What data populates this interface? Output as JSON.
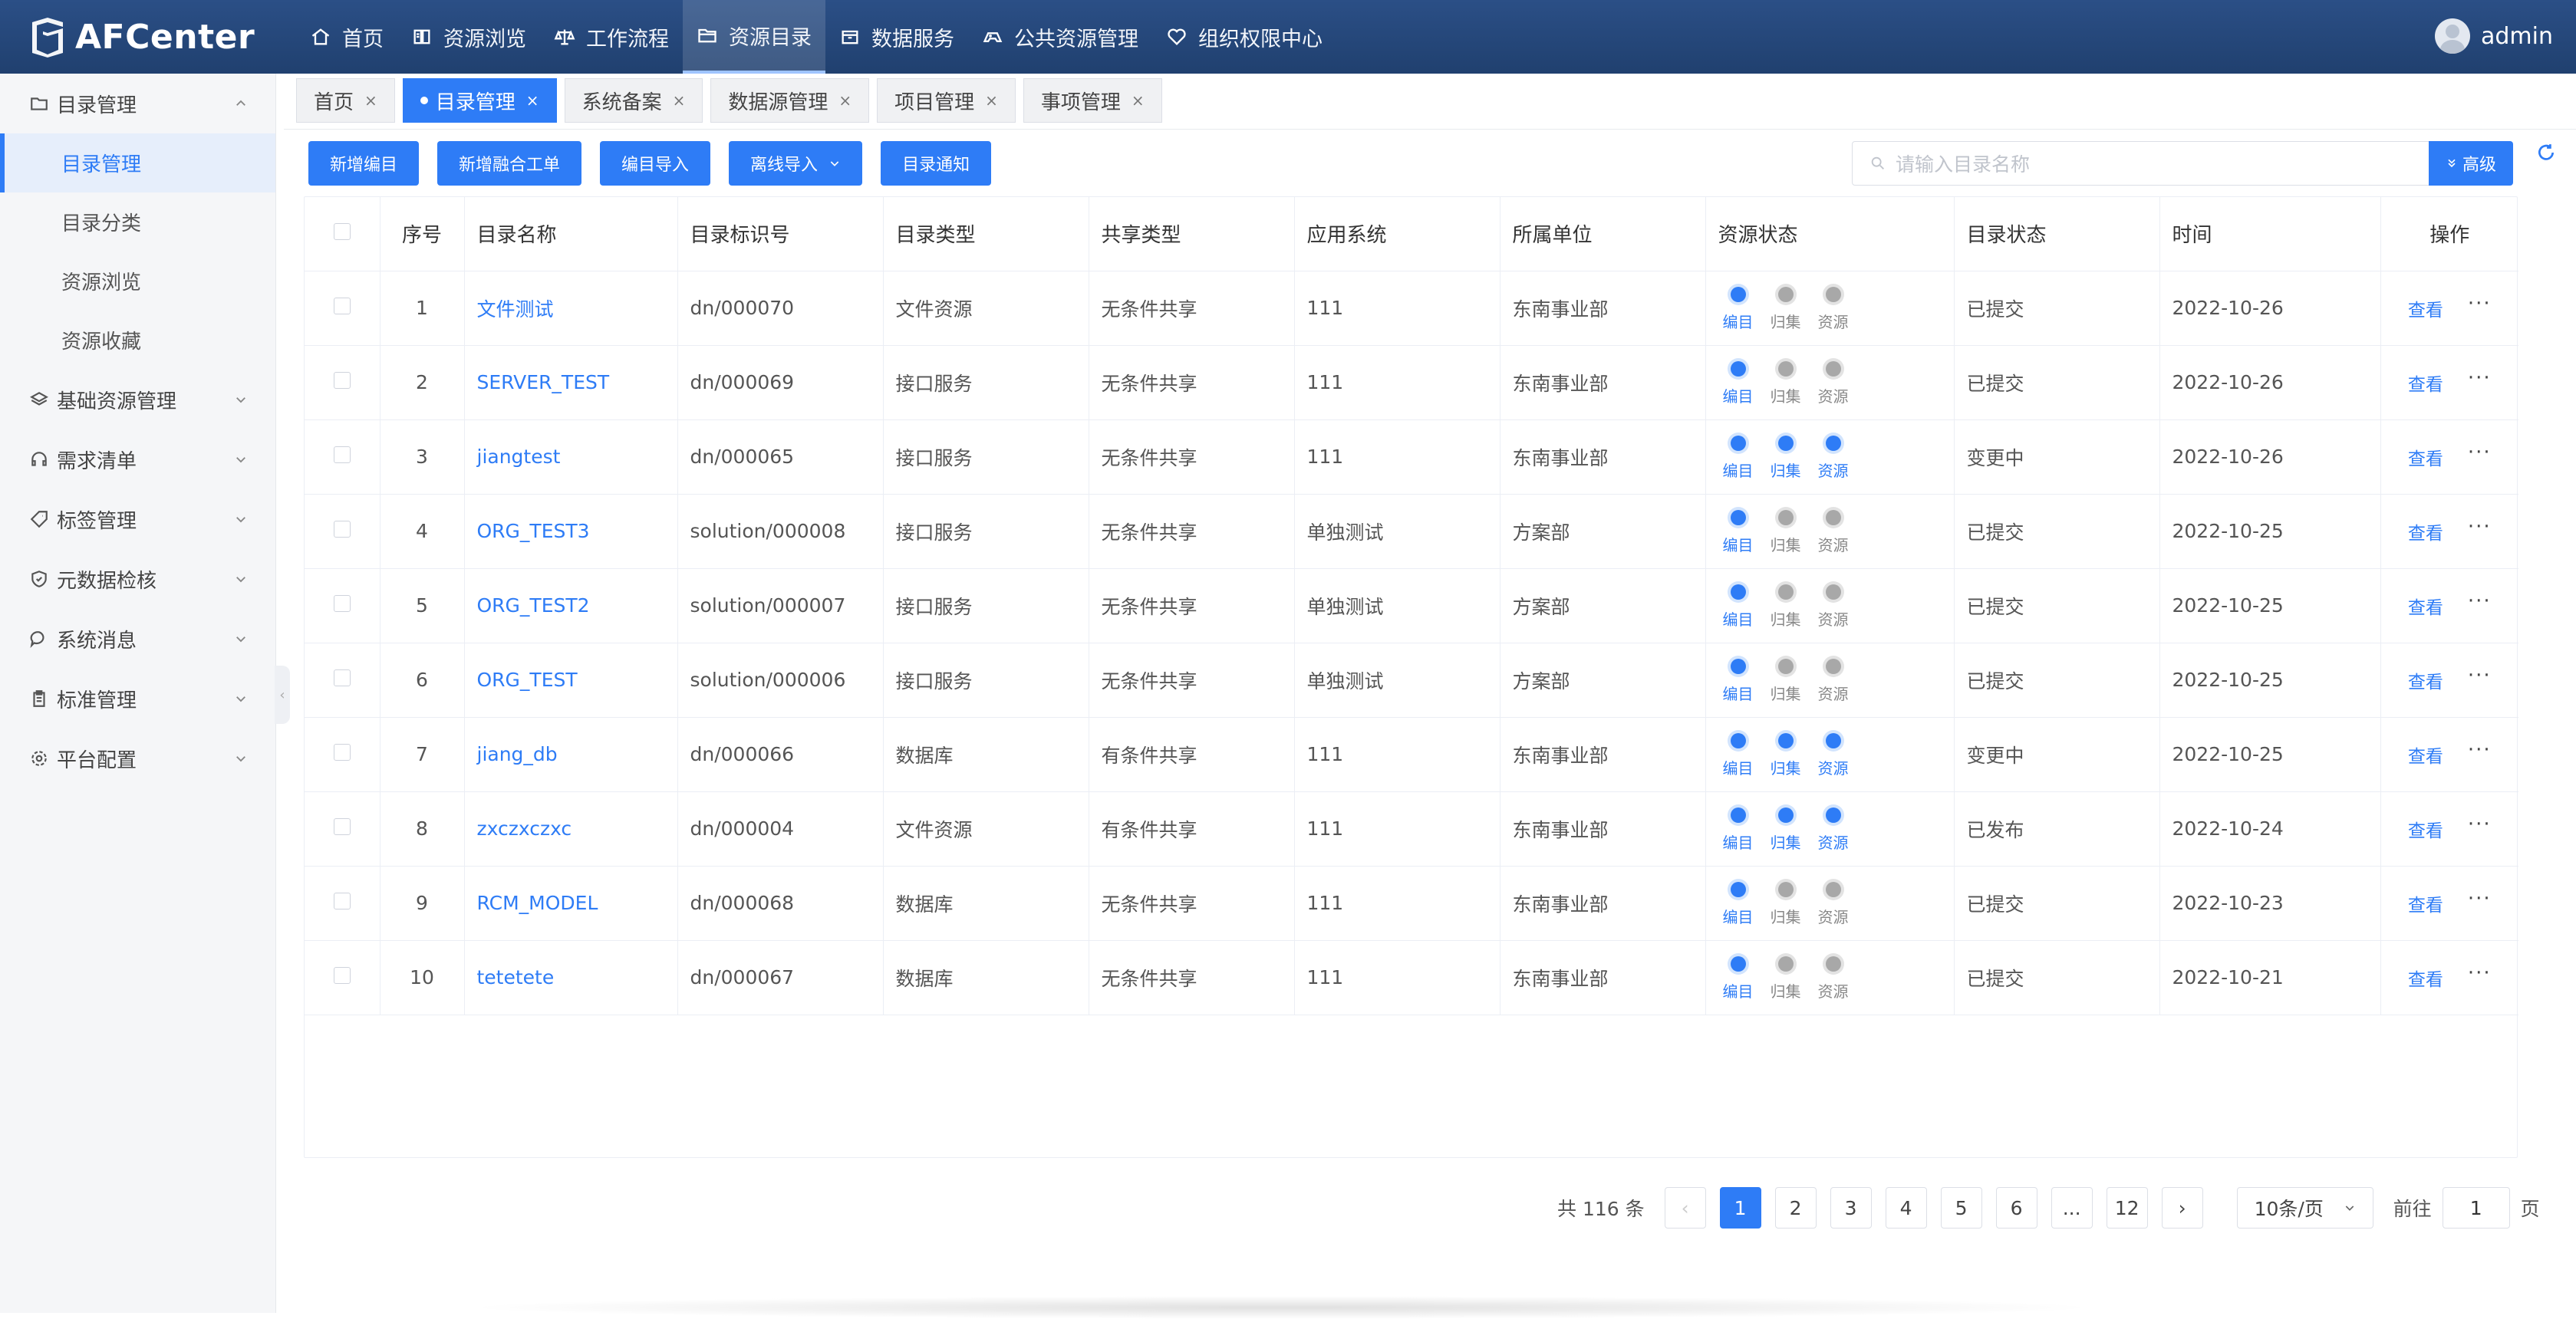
{
  "app": {
    "brand": "AFCenter",
    "user": "admin"
  },
  "nav": [
    {
      "label": "首页",
      "icon": "home-icon"
    },
    {
      "label": "资源浏览",
      "icon": "book-icon"
    },
    {
      "label": "工作流程",
      "icon": "scale-icon"
    },
    {
      "label": "资源目录",
      "icon": "folder-icon",
      "active": true
    },
    {
      "label": "数据服务",
      "icon": "box-icon"
    },
    {
      "label": "公共资源管理",
      "icon": "gamepad-icon"
    },
    {
      "label": "组织权限中心",
      "icon": "heart-icon"
    }
  ],
  "sidebar": {
    "catalog_group": "目录管理",
    "catalog_items": [
      "目录管理",
      "目录分类",
      "资源浏览",
      "资源收藏"
    ],
    "groups": [
      "基础资源管理",
      "需求清单",
      "标签管理",
      "元数据检核",
      "系统消息",
      "标准管理",
      "平台配置"
    ]
  },
  "tabs": [
    {
      "label": "首页"
    },
    {
      "label": "目录管理",
      "active": true
    },
    {
      "label": "系统备案"
    },
    {
      "label": "数据源管理"
    },
    {
      "label": "项目管理"
    },
    {
      "label": "事项管理"
    }
  ],
  "toolbar": {
    "new_catalog": "新增编目",
    "new_fusion": "新增融合工单",
    "import_catalog": "编目导入",
    "offline_import": "离线导入",
    "notify": "目录通知"
  },
  "search": {
    "placeholder": "请输入目录名称",
    "advanced": "高级"
  },
  "table": {
    "headers": [
      "序号",
      "目录名称",
      "目录标识号",
      "目录类型",
      "共享类型",
      "应用系统",
      "所属单位",
      "资源状态",
      "目录状态",
      "时间",
      "操作"
    ],
    "step_labels": [
      "编目",
      "归集",
      "资源"
    ],
    "view_label": "查看",
    "more_label": "···",
    "rows": [
      {
        "no": "1",
        "name": "文件测试",
        "code": "dn/000070",
        "type": "文件资源",
        "share": "无条件共享",
        "system": "111",
        "unit": "东南事业部",
        "steps": [
          1,
          0,
          0
        ],
        "status": "已提交",
        "time": "2022-10-26"
      },
      {
        "no": "2",
        "name": "SERVER_TEST",
        "code": "dn/000069",
        "type": "接口服务",
        "share": "无条件共享",
        "system": "111",
        "unit": "东南事业部",
        "steps": [
          1,
          0,
          0
        ],
        "status": "已提交",
        "time": "2022-10-26"
      },
      {
        "no": "3",
        "name": "jiangtest",
        "code": "dn/000065",
        "type": "接口服务",
        "share": "无条件共享",
        "system": "111",
        "unit": "东南事业部",
        "steps": [
          1,
          1,
          1
        ],
        "status": "变更中",
        "time": "2022-10-26"
      },
      {
        "no": "4",
        "name": "ORG_TEST3",
        "code": "solution/000008",
        "type": "接口服务",
        "share": "无条件共享",
        "system": "单独测试",
        "unit": "方案部",
        "steps": [
          1,
          0,
          0
        ],
        "status": "已提交",
        "time": "2022-10-25"
      },
      {
        "no": "5",
        "name": "ORG_TEST2",
        "code": "solution/000007",
        "type": "接口服务",
        "share": "无条件共享",
        "system": "单独测试",
        "unit": "方案部",
        "steps": [
          1,
          0,
          0
        ],
        "status": "已提交",
        "time": "2022-10-25"
      },
      {
        "no": "6",
        "name": "ORG_TEST",
        "code": "solution/000006",
        "type": "接口服务",
        "share": "无条件共享",
        "system": "单独测试",
        "unit": "方案部",
        "steps": [
          1,
          0,
          0
        ],
        "status": "已提交",
        "time": "2022-10-25"
      },
      {
        "no": "7",
        "name": "jiang_db",
        "code": "dn/000066",
        "type": "数据库",
        "share": "有条件共享",
        "system": "111",
        "unit": "东南事业部",
        "steps": [
          1,
          1,
          1
        ],
        "status": "变更中",
        "time": "2022-10-25"
      },
      {
        "no": "8",
        "name": "zxczxczxc",
        "code": "dn/000004",
        "type": "文件资源",
        "share": "有条件共享",
        "system": "111",
        "unit": "东南事业部",
        "steps": [
          1,
          1,
          1
        ],
        "status": "已发布",
        "time": "2022-10-24"
      },
      {
        "no": "9",
        "name": "RCM_MODEL",
        "code": "dn/000068",
        "type": "数据库",
        "share": "无条件共享",
        "system": "111",
        "unit": "东南事业部",
        "steps": [
          1,
          0,
          0
        ],
        "status": "已提交",
        "time": "2022-10-23"
      },
      {
        "no": "10",
        "name": "tetetete",
        "code": "dn/000067",
        "type": "数据库",
        "share": "无条件共享",
        "system": "111",
        "unit": "东南事业部",
        "steps": [
          1,
          0,
          0
        ],
        "status": "已提交",
        "time": "2022-10-21"
      }
    ]
  },
  "pagination": {
    "total": "共 116 条",
    "pages": [
      "1",
      "2",
      "3",
      "4",
      "5",
      "6",
      "...",
      "12"
    ],
    "current": "1",
    "page_size": "10条/页",
    "goto_label": "前往",
    "goto_value": "1",
    "page_suffix": "页"
  },
  "colors": {
    "primary": "#2e7cf6",
    "topbar": "#25487c"
  }
}
